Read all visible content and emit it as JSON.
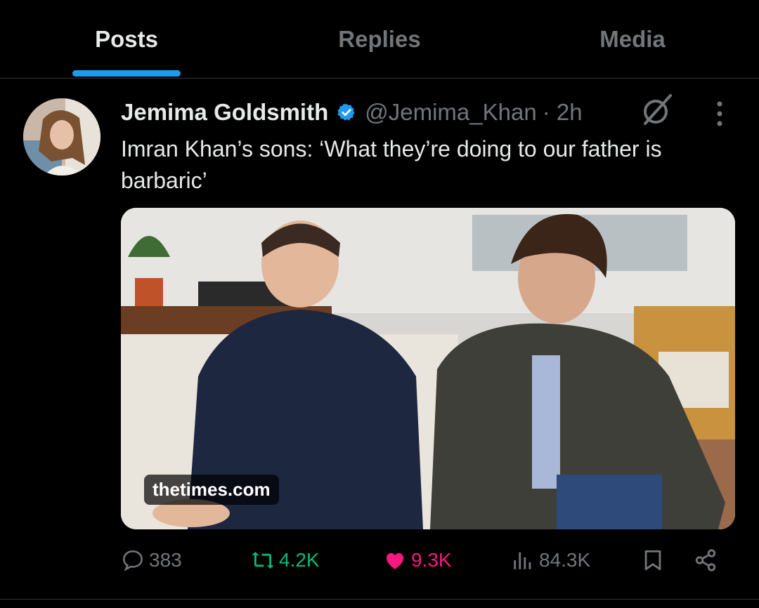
{
  "tabs": [
    {
      "label": "Posts",
      "active": true
    },
    {
      "label": "Replies",
      "active": false
    },
    {
      "label": "Media",
      "active": false
    }
  ],
  "tweet": {
    "author_name": "Jemima Goldsmith",
    "handle": "@Jemima_Khan",
    "time": "· 2h",
    "text": "Imran Khan’s sons: ‘What they’re doing to our father is barbaric’",
    "link_domain": "thetimes.com",
    "stats": {
      "replies": "383",
      "reposts": "4.2K",
      "likes": "9.3K",
      "views": "84.3K"
    }
  },
  "colors": {
    "accent": "#1d9bf0",
    "repost": "#00ba7c",
    "like": "#f91880",
    "muted": "#71767b",
    "text": "#e7e9ea",
    "background": "#000000"
  },
  "icons": [
    "verified-badge-icon",
    "grok-slash-icon",
    "more-icon",
    "reply-icon",
    "repost-icon",
    "like-icon",
    "views-icon",
    "bookmark-icon",
    "share-icon"
  ]
}
